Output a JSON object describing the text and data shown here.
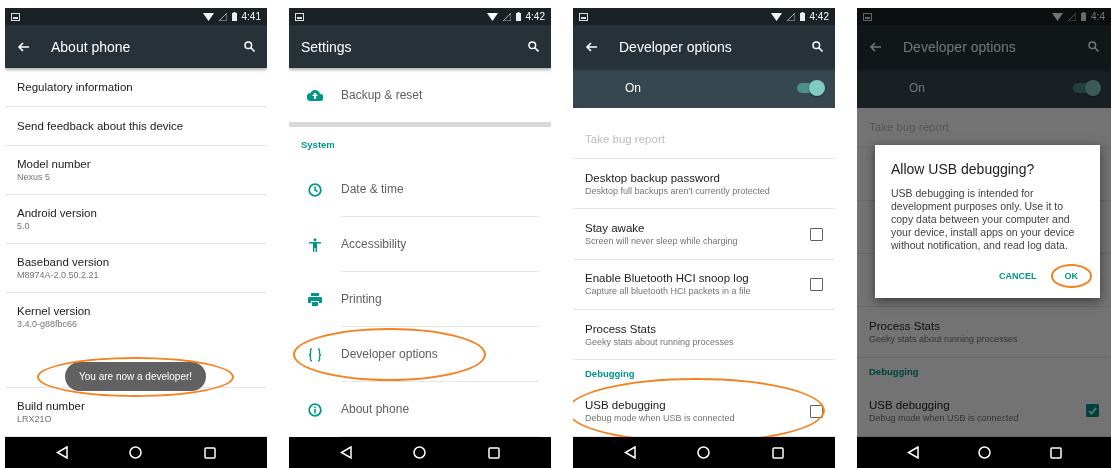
{
  "screens": [
    {
      "status_time": "4:41",
      "toolbar": {
        "title": "About phone",
        "back": true
      },
      "items": [
        {
          "kind": "pref",
          "title": "Regulatory information",
          "circled": false
        },
        {
          "kind": "pref",
          "title": "Send feedback about this device",
          "circled": false
        },
        {
          "kind": "pref",
          "title": "Model number",
          "summary": "Nexus 5",
          "circled": false
        },
        {
          "kind": "pref",
          "title": "Android version",
          "summary": "5.0",
          "circled": false
        },
        {
          "kind": "pref",
          "title": "Baseband version",
          "summary": "M8974A-2.0.50.2.21",
          "circled": false
        },
        {
          "kind": "pref",
          "title": "Kernel version",
          "summary": "3.4.0-g88fbc66",
          "circled": false,
          "tall": true
        },
        {
          "kind": "pref",
          "title": "Build number",
          "summary": "LRX21O",
          "circled": false
        }
      ],
      "toast": {
        "text": "You are now a developer!",
        "circled": true
      }
    },
    {
      "status_time": "4:42",
      "toolbar": {
        "title": "Settings",
        "back": false
      },
      "items": [
        {
          "kind": "icon",
          "title": "Backup & reset",
          "circled": false
        },
        {
          "kind": "header",
          "title": "System"
        },
        {
          "kind": "icon",
          "title": "Date & time",
          "circled": false
        },
        {
          "kind": "icon",
          "title": "Accessibility",
          "circled": false
        },
        {
          "kind": "icon",
          "title": "Printing",
          "circled": false
        },
        {
          "kind": "icon",
          "title": "Developer options",
          "circled": true
        },
        {
          "kind": "icon",
          "title": "About phone",
          "circled": false
        }
      ]
    },
    {
      "status_time": "4:42",
      "toolbar": {
        "title": "Developer options",
        "back": true
      },
      "master_switch": {
        "label": "On",
        "on": true
      },
      "items": [
        {
          "kind": "pref",
          "title": "Take bug report",
          "disabled": true,
          "circled": false
        },
        {
          "kind": "pref",
          "title": "Desktop backup password",
          "summary": "Desktop full backups aren't currently protected",
          "circled": false
        },
        {
          "kind": "check",
          "title": "Stay awake",
          "summary": "Screen will never sleep while charging",
          "checked": false,
          "circled": false
        },
        {
          "kind": "check",
          "title": "Enable Bluetooth HCI snoop log",
          "summary": "Capture all bluetooth HCI packets in a file",
          "checked": false,
          "circled": false
        },
        {
          "kind": "pref",
          "title": "Process Stats",
          "summary": "Geeky stats about running processes",
          "circled": false
        },
        {
          "kind": "header",
          "title": "Debugging"
        },
        {
          "kind": "check",
          "title": "USB debugging",
          "summary": "Debug mode when USB is connected",
          "checked": false,
          "circled": true
        }
      ]
    },
    {
      "status_time": "4:4",
      "toolbar": {
        "title": "Developer options",
        "back": true
      },
      "master_switch": {
        "label": "On",
        "on": true
      },
      "items": [
        {
          "kind": "pref",
          "title": "Take bug report",
          "disabled": true,
          "circled": false
        },
        {
          "kind": "covered"
        },
        {
          "kind": "covered"
        },
        {
          "kind": "covered"
        },
        {
          "kind": "pref",
          "title": "Process Stats",
          "summary": "Geeky stats about running processes",
          "circled": false
        },
        {
          "kind": "header",
          "title": "Debugging"
        },
        {
          "kind": "check",
          "title": "USB debugging",
          "summary": "Debug mode when USB is connected",
          "checked": true,
          "circled": false
        }
      ],
      "dialog": {
        "title": "Allow USB debugging?",
        "message": "USB debugging is intended for development purposes only. Use it to copy data between your computer and your device, install apps on your device without notification, and read log data.",
        "buttons": [
          {
            "label": "CANCEL",
            "circled": false
          },
          {
            "label": "OK",
            "circled": true
          }
        ]
      }
    }
  ]
}
